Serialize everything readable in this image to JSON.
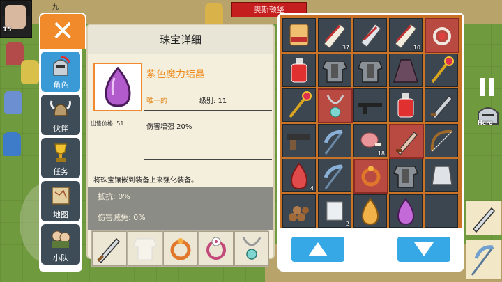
{
  "player": {
    "level": "15"
  },
  "top": {
    "banner_text": "奥斯顿堡",
    "name_glyph": "九"
  },
  "left_panel": {
    "close_icon": "close-icon",
    "tabs": [
      {
        "label": "角色",
        "icon": "knight-helmet-icon",
        "active": true
      },
      {
        "label": "伙伴",
        "icon": "viking-helmet-icon",
        "active": false
      },
      {
        "label": "任务",
        "icon": "trophy-icon",
        "active": false
      },
      {
        "label": "地图",
        "icon": "map-scroll-icon",
        "active": false
      },
      {
        "label": "小队",
        "icon": "party-icon",
        "active": false
      }
    ]
  },
  "detail": {
    "title": "珠宝详细",
    "item_name": "紫色魔力结晶",
    "rarity": "唯一的",
    "level": "级别: 11",
    "sell_price": "出售价格: 51",
    "effect": "伤害增强 20%",
    "description": "将珠宝镶嵌到装备上来强化装备。",
    "obscured_lines": [
      "抵抗: 0%",
      "伤害减免: 0%"
    ]
  },
  "equip_row": {
    "slots": [
      "sword-icon",
      "armor-silhouette-icon",
      "orange-ring-icon",
      "flower-ring-icon",
      "necklace-icon"
    ]
  },
  "inventory": {
    "rows": [
      [
        {
          "icon": "red-scroll-icon",
          "count": ""
        },
        {
          "icon": "scroll-icon",
          "count": "37"
        },
        {
          "icon": "striped-scroll-icon",
          "count": ""
        },
        {
          "icon": "scroll-icon",
          "count": "10"
        },
        {
          "icon": "red-ring-icon",
          "count": "",
          "highlight": true
        }
      ],
      [
        {
          "icon": "red-potion-icon",
          "count": ""
        },
        {
          "icon": "chest-armor-icon",
          "count": ""
        },
        {
          "icon": "chest-armor-icon",
          "count": ""
        },
        {
          "icon": "cloak-icon",
          "count": ""
        },
        {
          "icon": "staff-icon",
          "count": ""
        }
      ],
      [
        {
          "icon": "staff-icon",
          "count": ""
        },
        {
          "icon": "silver-necklace-icon",
          "count": "",
          "highlight": true
        },
        {
          "icon": "rifle-icon",
          "count": ""
        },
        {
          "icon": "red-potion-icon",
          "count": ""
        },
        {
          "icon": "dagger-icon",
          "count": ""
        }
      ],
      [
        {
          "icon": "pistol-icon",
          "count": ""
        },
        {
          "icon": "scythe-icon",
          "count": ""
        },
        {
          "icon": "meat-icon",
          "count": "18"
        },
        {
          "icon": "red-dagger-icon",
          "count": "",
          "highlight": true
        },
        {
          "icon": "bow-icon",
          "count": ""
        }
      ],
      [
        {
          "icon": "red-gem-icon",
          "count": "4"
        },
        {
          "icon": "scythe-icon",
          "count": ""
        },
        {
          "icon": "orange-ring-icon",
          "count": "",
          "highlight": true
        },
        {
          "icon": "chest-armor-icon",
          "count": ""
        },
        {
          "icon": "silver-ingot-icon",
          "count": ""
        }
      ],
      [
        {
          "icon": "wood-logs-icon",
          "count": ""
        },
        {
          "icon": "silver-block-icon",
          "count": "2"
        },
        {
          "icon": "orange-gem-icon",
          "count": ""
        },
        {
          "icon": "purple-gem-icon",
          "count": ""
        },
        {
          "icon": "empty",
          "count": ""
        }
      ]
    ],
    "scroll_up": "arrow-up-icon",
    "scroll_down": "arrow-down-icon"
  },
  "right_ui": {
    "hero_label": "Hero"
  },
  "colors": {
    "accent_orange": "#f08a2a",
    "tab_active": "#3a9ad6",
    "button_blue": "#36a8e6",
    "rarity_orange": "#ef8a1c"
  }
}
